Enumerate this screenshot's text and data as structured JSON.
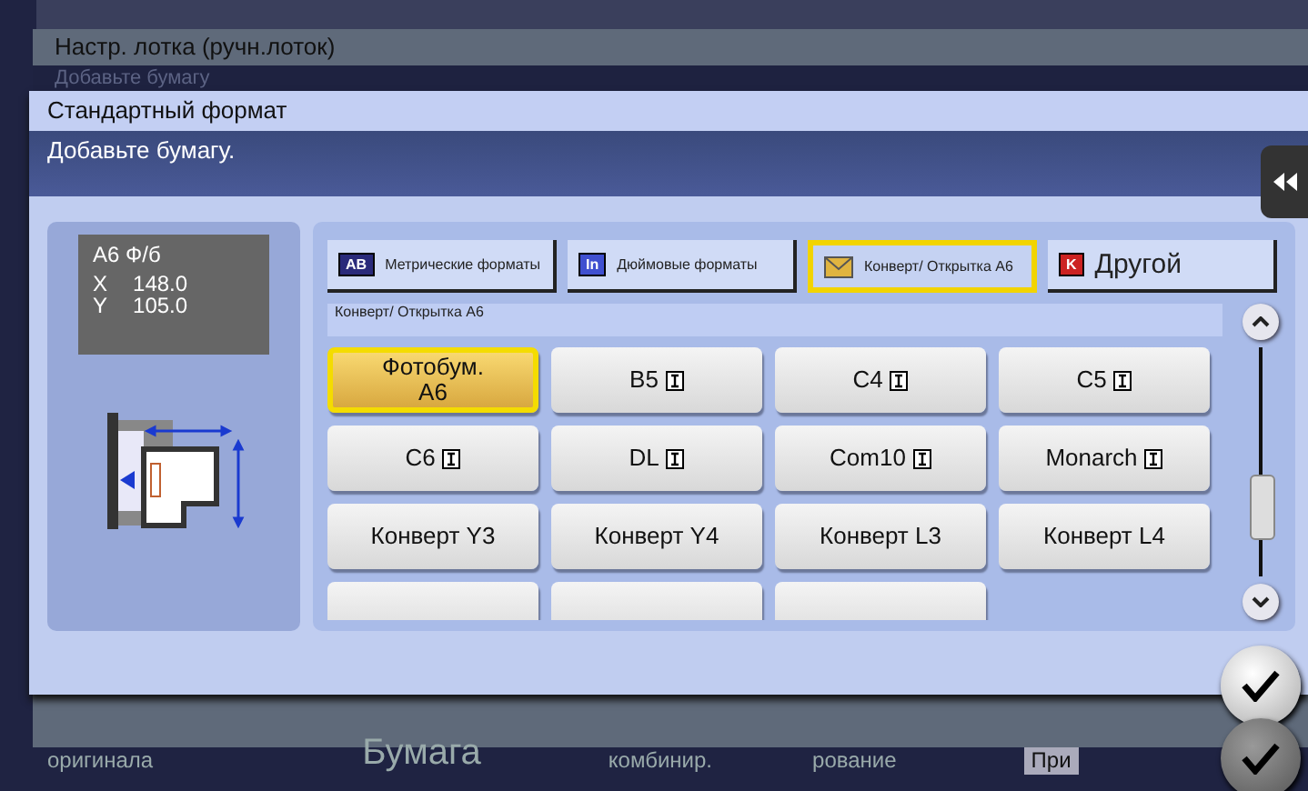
{
  "back_dialog": {
    "title": "Настр. лотка (ручн.лоток)",
    "message": "Добавьте бумагу"
  },
  "dialog": {
    "title": "Стандартный формат",
    "message": "Добавьте бумагу."
  },
  "size_info": {
    "name": "A6 Ф/б",
    "rows": [
      {
        "axis": "X",
        "value": "148.0"
      },
      {
        "axis": "Y",
        "value": "105.0"
      }
    ]
  },
  "categories": [
    {
      "label": "Метрические форматы",
      "icon": "AB",
      "kind": "metric",
      "selected": false
    },
    {
      "label": "Дюймовые форматы",
      "icon": "In",
      "kind": "inch",
      "selected": false
    },
    {
      "label": "Конверт/ Открытка А6",
      "kind": "envelope",
      "selected": true
    },
    {
      "label": "Другой",
      "icon": "K",
      "kind": "other",
      "selected": false
    }
  ],
  "section_label": "Конверт/ Открытка А6",
  "sizes": [
    {
      "label": "Фотобум. А6",
      "kind": "plain",
      "selected": true
    },
    {
      "label": "B5",
      "kind": "orient",
      "selected": false
    },
    {
      "label": "C4",
      "kind": "orient",
      "selected": false
    },
    {
      "label": "C5",
      "kind": "orient",
      "selected": false
    },
    {
      "label": "C6",
      "kind": "orient",
      "selected": false
    },
    {
      "label": "DL",
      "kind": "orient",
      "selected": false
    },
    {
      "label": "Com10",
      "kind": "orient",
      "selected": false
    },
    {
      "label": "Monarch",
      "kind": "orient",
      "selected": false
    },
    {
      "label": "Конверт Y3",
      "kind": "plain",
      "selected": false
    },
    {
      "label": "Конверт Y4",
      "kind": "plain",
      "selected": false
    },
    {
      "label": "Конверт L3",
      "kind": "plain",
      "selected": false
    },
    {
      "label": "Конверт L4",
      "kind": "plain",
      "selected": false
    },
    {
      "kind": "cut",
      "selected": false
    },
    {
      "kind": "cut",
      "selected": false
    },
    {
      "kind": "cut",
      "selected": false
    }
  ],
  "bottom_nav": [
    {
      "label": "оригинала",
      "kind": "tab",
      "selected": false
    },
    {
      "label": "Бумага",
      "kind": "tab",
      "selected": true
    },
    {
      "label": "комбинир.",
      "kind": "tab",
      "selected": false
    },
    {
      "label": "рование",
      "kind": "tab",
      "selected": false
    },
    {
      "label": "При",
      "kind": "button",
      "selected": false
    }
  ]
}
